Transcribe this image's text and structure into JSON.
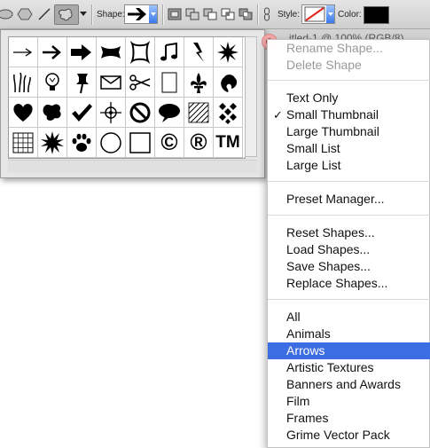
{
  "toolbar": {
    "shape_label": "Shape:",
    "style_label": "Style:",
    "color_label": "Color:",
    "color_value": "#000000",
    "tools": [
      "ellipse-tool-icon",
      "polygon-tool-icon",
      "line-tool-icon",
      "custom-shape-tool-icon"
    ],
    "path_ops": [
      "create-new-shape-icon",
      "add-to-shape-icon",
      "subtract-shape-icon",
      "intersect-shape-icon",
      "exclude-shape-icon"
    ]
  },
  "background_tab": {
    "text": "itled-1 @ 100% (RGB/8)"
  },
  "picker": {
    "shapes": [
      [
        "thin-arrow",
        "arrow",
        "bold-arrow",
        "banner",
        "frame",
        "music-note",
        "lightning",
        "starburst"
      ],
      [
        "grass",
        "light-bulb",
        "thumbtack",
        "envelope",
        "scissors",
        "blank-page",
        "fleur-de-lis",
        "leaf"
      ],
      [
        "heart",
        "blob",
        "checkmark",
        "target",
        "no-sign",
        "speech-bubble",
        "stripes",
        "diamond-grid"
      ],
      [
        "grid",
        "burst",
        "paw-print",
        "circle",
        "square",
        "copyright",
        "registered",
        "trademark"
      ]
    ],
    "copyright_symbol": "©",
    "registered_symbol": "®",
    "trademark_symbol": "TM"
  },
  "menu": {
    "groups": [
      [
        {
          "label": "Rename Shape...",
          "disabled": true
        },
        {
          "label": "Delete Shape",
          "disabled": true
        }
      ],
      [
        {
          "label": "Text Only"
        },
        {
          "label": "Small Thumbnail",
          "checked": true
        },
        {
          "label": "Large Thumbnail"
        },
        {
          "label": "Small List"
        },
        {
          "label": "Large List"
        }
      ],
      [
        {
          "label": "Preset Manager..."
        }
      ],
      [
        {
          "label": "Reset Shapes..."
        },
        {
          "label": "Load Shapes..."
        },
        {
          "label": "Save Shapes..."
        },
        {
          "label": "Replace Shapes..."
        }
      ],
      [
        {
          "label": "All"
        },
        {
          "label": "Animals"
        },
        {
          "label": "Arrows",
          "selected": true
        },
        {
          "label": "Artistic Textures"
        },
        {
          "label": "Banners and Awards"
        },
        {
          "label": "Film"
        },
        {
          "label": "Frames"
        },
        {
          "label": "Grime Vector Pack"
        }
      ]
    ],
    "check_mark": "✓"
  }
}
